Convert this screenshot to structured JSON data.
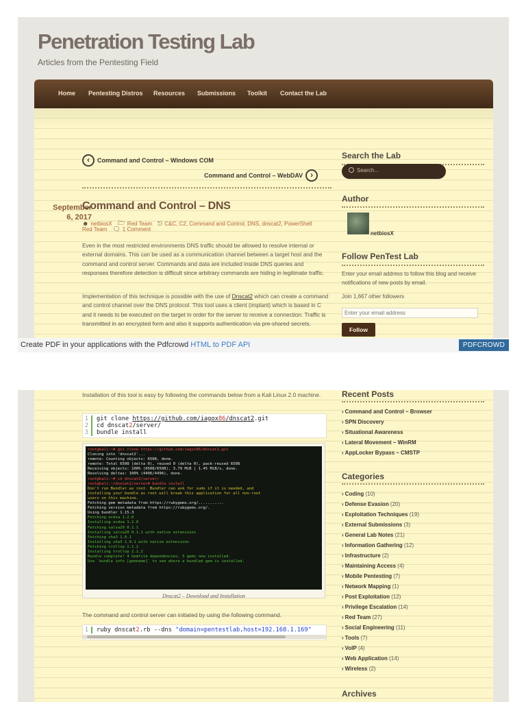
{
  "site": {
    "title": "Penetration Testing Lab",
    "tagline": "Articles from the Pentesting Field"
  },
  "nav": [
    "Home",
    "Pentesting Distros",
    "Resources",
    "Submissions",
    "Toolkit",
    "Contact the Lab"
  ],
  "post_nav": {
    "prev": "Command and Control – Windows COM",
    "next": "Command and Control – WebDAV",
    "prev_icon": "chevron-left-icon",
    "next_icon": "chevron-right-icon"
  },
  "post": {
    "date_line1": "September",
    "date_line2": "6, 2017",
    "title": "Command and Control – DNS",
    "author": "netbiosX",
    "category": "Red Team",
    "tags": "C&C, C2, Command and Control, DNS, dnscat2, PowerShell",
    "tags_cont": "Red Team",
    "comments": "1 Comment",
    "para1": "Even in the most restricted environments DNS traffic should be allowed to resolve internal or external domains. This can be used as a communication channel between a target host and the command and control server. Commands and data are included inside DNS queries and responses therefore detection is difficult since arbitrary commands are hiding in legitimate traffic.",
    "para2_pre": "Implementation of this technique is possible with the use of ",
    "para2_link": "Dnscat2",
    "para2_post": " which can create a command and control channel over the DNS protocol. This tool uses a client (implant) which is based in C and it needs to be executed on the target in order for the server to receive a connection. Traffic is transmitted in an encrypted form and also it supports authentication via pre-shared secrets.",
    "para3": "Installation of this tool is easy by following the commands below from a Kali Linux 2.0 machine.",
    "para4": "The command and control server can initiated by using the following command."
  },
  "code1": {
    "line_numbers": [
      "1",
      "2",
      "3"
    ],
    "l1_cmd": "git clone ",
    "l1_url_a": "https://github.com/iagox",
    "l1_url_num": "86",
    "l1_url_b": "/dnscat2",
    "l1_tail": ".git",
    "l2_a": "cd dnscat",
    "l2_num": "2",
    "l2_b": "/server/",
    "l3": "bundle install"
  },
  "code2": {
    "line_number": "1",
    "cmd_a": "ruby dnscat",
    "cmd_num": "2",
    "cmd_b": ".rb --dns ",
    "cmd_str": "\"domain=pentestlab,host=192.168.1.169\""
  },
  "terminal_lines": [
    {
      "c": "t-r",
      "t": "root@kali:~# git clone https://github.com/iagox86/dnscat2.git"
    },
    {
      "c": "t-w",
      "t": "Cloning into 'dnscat2'..."
    },
    {
      "c": "t-w",
      "t": "remote: Counting objects: 6508, done."
    },
    {
      "c": "t-w",
      "t": "remote: Total 6508 (delta 0), reused 0 (delta 0), pack-reused 6508"
    },
    {
      "c": "t-w",
      "t": "Receiving objects: 100% (6508/6508), 3.79 MiB | 1.45 MiB/s, done."
    },
    {
      "c": "t-w",
      "t": "Resolving deltas: 100% (4496/4496), done."
    },
    {
      "c": "t-r",
      "t": "root@kali:~# cd dnscat2/server/"
    },
    {
      "c": "t-r",
      "t": "root@kali:~/dnscat2/server# bundle install"
    },
    {
      "c": "t-y",
      "t": "Don't run Bundler as root. Bundler can ask for sudo if it is needed, and"
    },
    {
      "c": "t-y",
      "t": "installing your bundle as root will break this application for all non-root"
    },
    {
      "c": "t-y",
      "t": "users on this machine."
    },
    {
      "c": "t-w",
      "t": "Fetching gem metadata from https://rubygems.org/..........."
    },
    {
      "c": "t-w",
      "t": "Fetching version metadata from https://rubygems.org/."
    },
    {
      "c": "t-w",
      "t": "Using bundler 1.15.3"
    },
    {
      "c": "t-g",
      "t": "Fetching ecdsa 1.2.0"
    },
    {
      "c": "t-g",
      "t": "Installing ecdsa 1.2.0"
    },
    {
      "c": "t-g",
      "t": "Fetching salsa20 0.1.1"
    },
    {
      "c": "t-g",
      "t": "Installing salsa20 0.1.1 with native extensions"
    },
    {
      "c": "t-g",
      "t": "Fetching sha3 1.0.1"
    },
    {
      "c": "t-g",
      "t": "Installing sha3 1.0.1 with native extensions"
    },
    {
      "c": "t-g",
      "t": "Fetching trollop 2.1.2"
    },
    {
      "c": "t-g",
      "t": "Installing trollop 2.1.2"
    },
    {
      "c": "t-g",
      "t": "Bundle complete! 4 Gemfile dependencies, 5 gems now installed."
    },
    {
      "c": "t-g",
      "t": "Use `bundle info [gemname]` to see where a bundled gem is installed."
    }
  ],
  "figure_caption": "Dnscat2 – Download and Installation",
  "sidebar": {
    "search_title": "Search the Lab",
    "search_placeholder": "Search...",
    "author_title": "Author",
    "author_name": "netbiosX",
    "follow_title": "Follow PenTest Lab",
    "follow_text": "Enter your email address to follow this blog and receive notifications of new posts by email.",
    "followers": "Join 1,667 other followers",
    "email_placeholder": "Enter your email address",
    "follow_button": "Follow",
    "recent_title": "Recent Posts",
    "recent": [
      "Command and Control – Browser",
      "SPN Discovery",
      "Situational Awareness",
      "Lateral Movement – WinRM",
      "AppLocker Bypass – CMSTP"
    ],
    "categories_title": "Categories",
    "categories": [
      {
        "name": "Coding",
        "count": "(10)"
      },
      {
        "name": "Defense Evasion",
        "count": "(20)"
      },
      {
        "name": "Exploitation Techniques",
        "count": "(19)"
      },
      {
        "name": "External Submissions",
        "count": "(3)"
      },
      {
        "name": "General Lab Notes",
        "count": "(21)"
      },
      {
        "name": "Information Gathering",
        "count": "(12)"
      },
      {
        "name": "Infrastructure",
        "count": "(2)"
      },
      {
        "name": "Maintaining Access",
        "count": "(4)"
      },
      {
        "name": "Mobile Pentesting",
        "count": "(7)"
      },
      {
        "name": "Network Mapping",
        "count": "(1)"
      },
      {
        "name": "Post Exploitation",
        "count": "(12)"
      },
      {
        "name": "Privilege Escalation",
        "count": "(14)"
      },
      {
        "name": "Red Team",
        "count": "(27)"
      },
      {
        "name": "Social Engineering",
        "count": "(11)"
      },
      {
        "name": "Tools",
        "count": "(7)"
      },
      {
        "name": "VoIP",
        "count": "(4)"
      },
      {
        "name": "Web Application",
        "count": "(14)"
      },
      {
        "name": "Wireless",
        "count": "(2)"
      }
    ],
    "archives_title": "Archives"
  },
  "pdf_bar": {
    "text": "Create PDF in your applications with the Pdfcrowd ",
    "link": "HTML to PDF API",
    "badge": "PDFCROWD"
  }
}
